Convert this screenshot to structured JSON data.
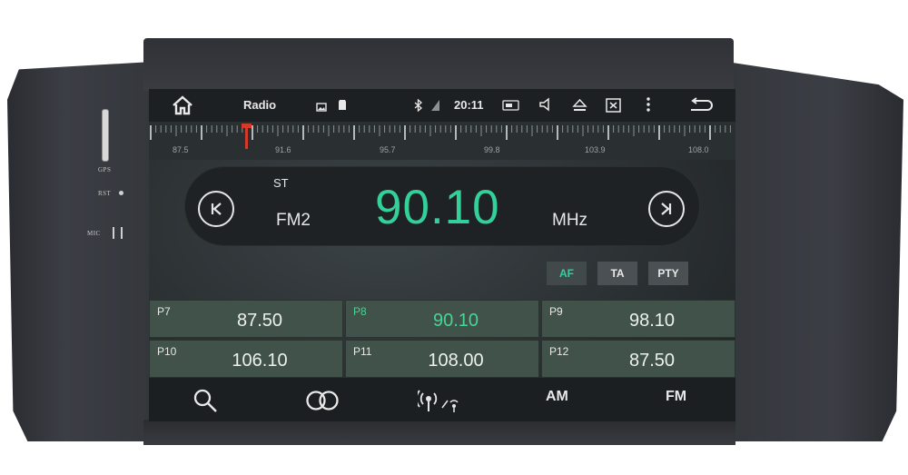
{
  "device": {
    "labels": {
      "gps": "GPS",
      "rst": "RST",
      "mic": "MIC"
    }
  },
  "statusbar": {
    "title": "Radio",
    "time": "20:11",
    "icons": [
      "home-icon",
      "image-icon",
      "sd-card-icon",
      "bluetooth-icon",
      "signal-icon",
      "battery-icon",
      "volume-icon",
      "eject-icon",
      "close-box-icon",
      "more-icon",
      "back-icon"
    ]
  },
  "scale": {
    "labels": [
      "87.5",
      "91.6",
      "95.7",
      "99.8",
      "103.9",
      "108.0"
    ]
  },
  "tuner": {
    "stereo": "ST",
    "band": "FM2",
    "frequency": "90.10",
    "unit": "MHz",
    "accent": "#33d09a"
  },
  "toggles": [
    {
      "label": "AF",
      "active": true
    },
    {
      "label": "TA",
      "active": false
    },
    {
      "label": "PTY",
      "active": false
    }
  ],
  "presets": [
    {
      "num": "P7",
      "freq": "87.50",
      "active": false
    },
    {
      "num": "P8",
      "freq": "90.10",
      "active": true
    },
    {
      "num": "P9",
      "freq": "98.10",
      "active": false
    },
    {
      "num": "P10",
      "freq": "106.10",
      "active": false
    },
    {
      "num": "P11",
      "freq": "108.00",
      "active": false
    },
    {
      "num": "P12",
      "freq": "87.50",
      "active": false
    }
  ],
  "bottombar": {
    "am": "AM",
    "fm": "FM",
    "icons": [
      "search-icon",
      "stereo-icon",
      "antenna-icon"
    ]
  }
}
